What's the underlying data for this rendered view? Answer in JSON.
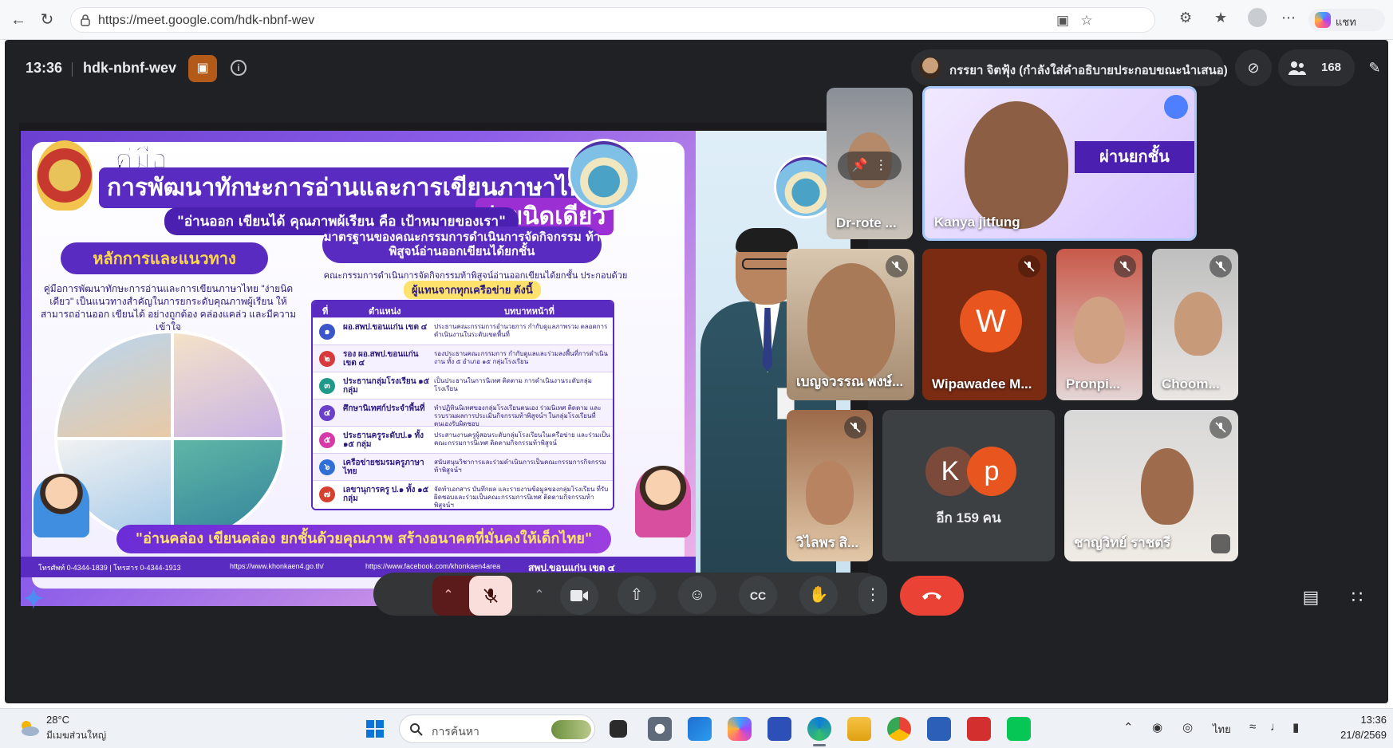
{
  "browser": {
    "url": "https://meet.google.com/hdk-nbnf-wev",
    "copilot_label": "แชท"
  },
  "meet": {
    "time": "13:36",
    "meeting_code": "hdk-nbnf-wev",
    "presenter_label": "กรรยา จิตฟุ้ง (กำลังใส่คำอธิบายประกอบขณะนำเสนอ)",
    "participant_count": "168"
  },
  "slide": {
    "title_line1": "คู่มือ",
    "title_line2": "การพัฒนาทักษะการอ่านและการเขียนภาษาไทย",
    "title_line3": "ง่ายนิดเดียว",
    "motto": "\"อ่านออก เขียนได้ คุณภาพผู้เรียน คือ เป้าหมายของเรา\"",
    "left_heading": "หลักการและแนวทาง",
    "left_description": "คู่มือการพัฒนาทักษะการอ่านและการเขียนภาษาไทย \"ง่ายนิดเดียว\" เป็นแนวทางสำคัญในการยกระดับคุณภาพผู้เรียน ให้สามารถอ่านออก เขียนได้ อย่างถูกต้อง คล่องแคล่ว และมีความเข้าใจ",
    "right_heading": "มาตรฐานของคณะกรรมการดำเนินการจัดกิจกรรม ท้าพิสูจน์อ่านออกเขียนได้ยกชั้น",
    "right_sub": "คณะกรรมการดำเนินการจัดกิจกรรมท้าพิสูจน์อ่านออกเขียนได้ยกชั้น ประกอบด้วย",
    "right_sub2": "ผู้แทนจากทุกเครือข่าย ดังนี้",
    "table_headers": {
      "no": "ที่",
      "position": "ตำแหน่ง",
      "role": "บทบาทหน้าที่"
    },
    "table_rows": [
      {
        "no": "๑",
        "position": "ผอ.สพป.ขอนแก่น เขต ๔",
        "role": "ประธานคณะกรรมการอำนวยการ กำกับดูแลภาพรวม ตลอดการดำเนินงานในระดับเขตพื้นที่",
        "color": "#3a56c9"
      },
      {
        "no": "๒",
        "position": "รอง ผอ.สพป.ขอนแก่น เขต ๔",
        "role": "รองประธานคณะกรรมการ กำกับดูแลและร่วมลงพื้นที่การดำเนินงาน ทั้ง ๕ อำเภอ ๑๕ กลุ่มโรงเรียน",
        "color": "#d63a3a"
      },
      {
        "no": "๓",
        "position": "ประธานกลุ่มโรงเรียน ๑๕ กลุ่ม",
        "role": "เป็นประธานในการนิเทศ ติดตาม การดำเนินงานระดับกลุ่มโรงเรียน",
        "color": "#1f9a8a"
      },
      {
        "no": "๔",
        "position": "ศึกษานิเทศก์ประจำพื้นที่",
        "role": "ทำปฏิทินนิเทศของกลุ่มโรงเรียนตนเอง ร่วมนิเทศ ติดตาม และรวบรวมผลการประเมินกิจกรรมท้าพิสูจน์ฯ ในกลุ่มโรงเรียนที่ตนเองรับผิดชอบ",
        "color": "#6a3fc9"
      },
      {
        "no": "๕",
        "position": "ประธานครูระดับป.๑ ทั้ง ๑๕ กลุ่ม",
        "role": "ประสานงานครูผู้สอนระดับกลุ่มโรงเรียนในเครือข่าย และร่วมเป็นคณะกรรมการนิเทศ ติดตามกิจกรรมท้าพิสูจน์",
        "color": "#d63aa8"
      },
      {
        "no": "๖",
        "position": "เครือข่ายชมรมครูภาษาไทย",
        "role": "สนับสนุนวิชาการและร่วมดำเนินการเป็นคณะกรรมการกิจกรรมท้าพิสูจน์ฯ",
        "color": "#2f6fd6"
      },
      {
        "no": "๗",
        "position": "เลขานุการครู ป.๑ ทั้ง ๑๕ กลุ่ม",
        "role": "จัดทำเอกสาร บันทึกผล และรายงานข้อมูลของกลุ่มโรงเรียน ที่รับผิดชอบและร่วมเป็นคณะกรรมการนิเทศ ติดตามกิจกรรมท้าพิสูจน์ฯ",
        "color": "#d6402f"
      }
    ],
    "footer_banner": "\"อ่านคล่อง เขียนคล่อง ยกชั้นด้วยคุณภาพ สร้างอนาคตที่มั่นคงให้เด็กไทย\"",
    "contacts": {
      "phone": "โทรศัพท์ 0-4344-1839 | โทรสาร 0-4344-1913",
      "web": "https://www.khonkaen4.go.th/",
      "facebook": "https://www.facebook.com/khonkaen4area",
      "office": "สพป.ขอนแก่น เขต ๔"
    }
  },
  "participants": [
    {
      "name": "Dr-rote ...",
      "pinned": true
    },
    {
      "name": "Kanya jitfung",
      "speaking": true
    },
    {
      "name": "เบญจวรรณ พงษ์...",
      "muted": true
    },
    {
      "name": "Wipawadee M...",
      "muted": true,
      "initial": "W"
    },
    {
      "name": "Pronpi...",
      "muted": true
    },
    {
      "name": "Choom...",
      "muted": true
    },
    {
      "name": "วิไลพร สิ...",
      "muted": true
    },
    {
      "name": "ชาญวิทย์ ราชตรี",
      "muted": true
    }
  ],
  "more_tile": {
    "initials": [
      "K",
      "p"
    ],
    "label": "อีก 159 คน"
  },
  "taskbar": {
    "weather_temp": "28°C",
    "weather_desc": "มีเมฆส่วนใหญ่",
    "search_placeholder": "การค้นหา",
    "language": "ไทย",
    "clock_time": "13:36",
    "clock_date": "21/8/2569"
  },
  "colors": {
    "meet_bg": "#202124",
    "end_call": "#ea4335",
    "mic_off_bg": "#f9dedc",
    "accent_orange": "#e9551e"
  }
}
